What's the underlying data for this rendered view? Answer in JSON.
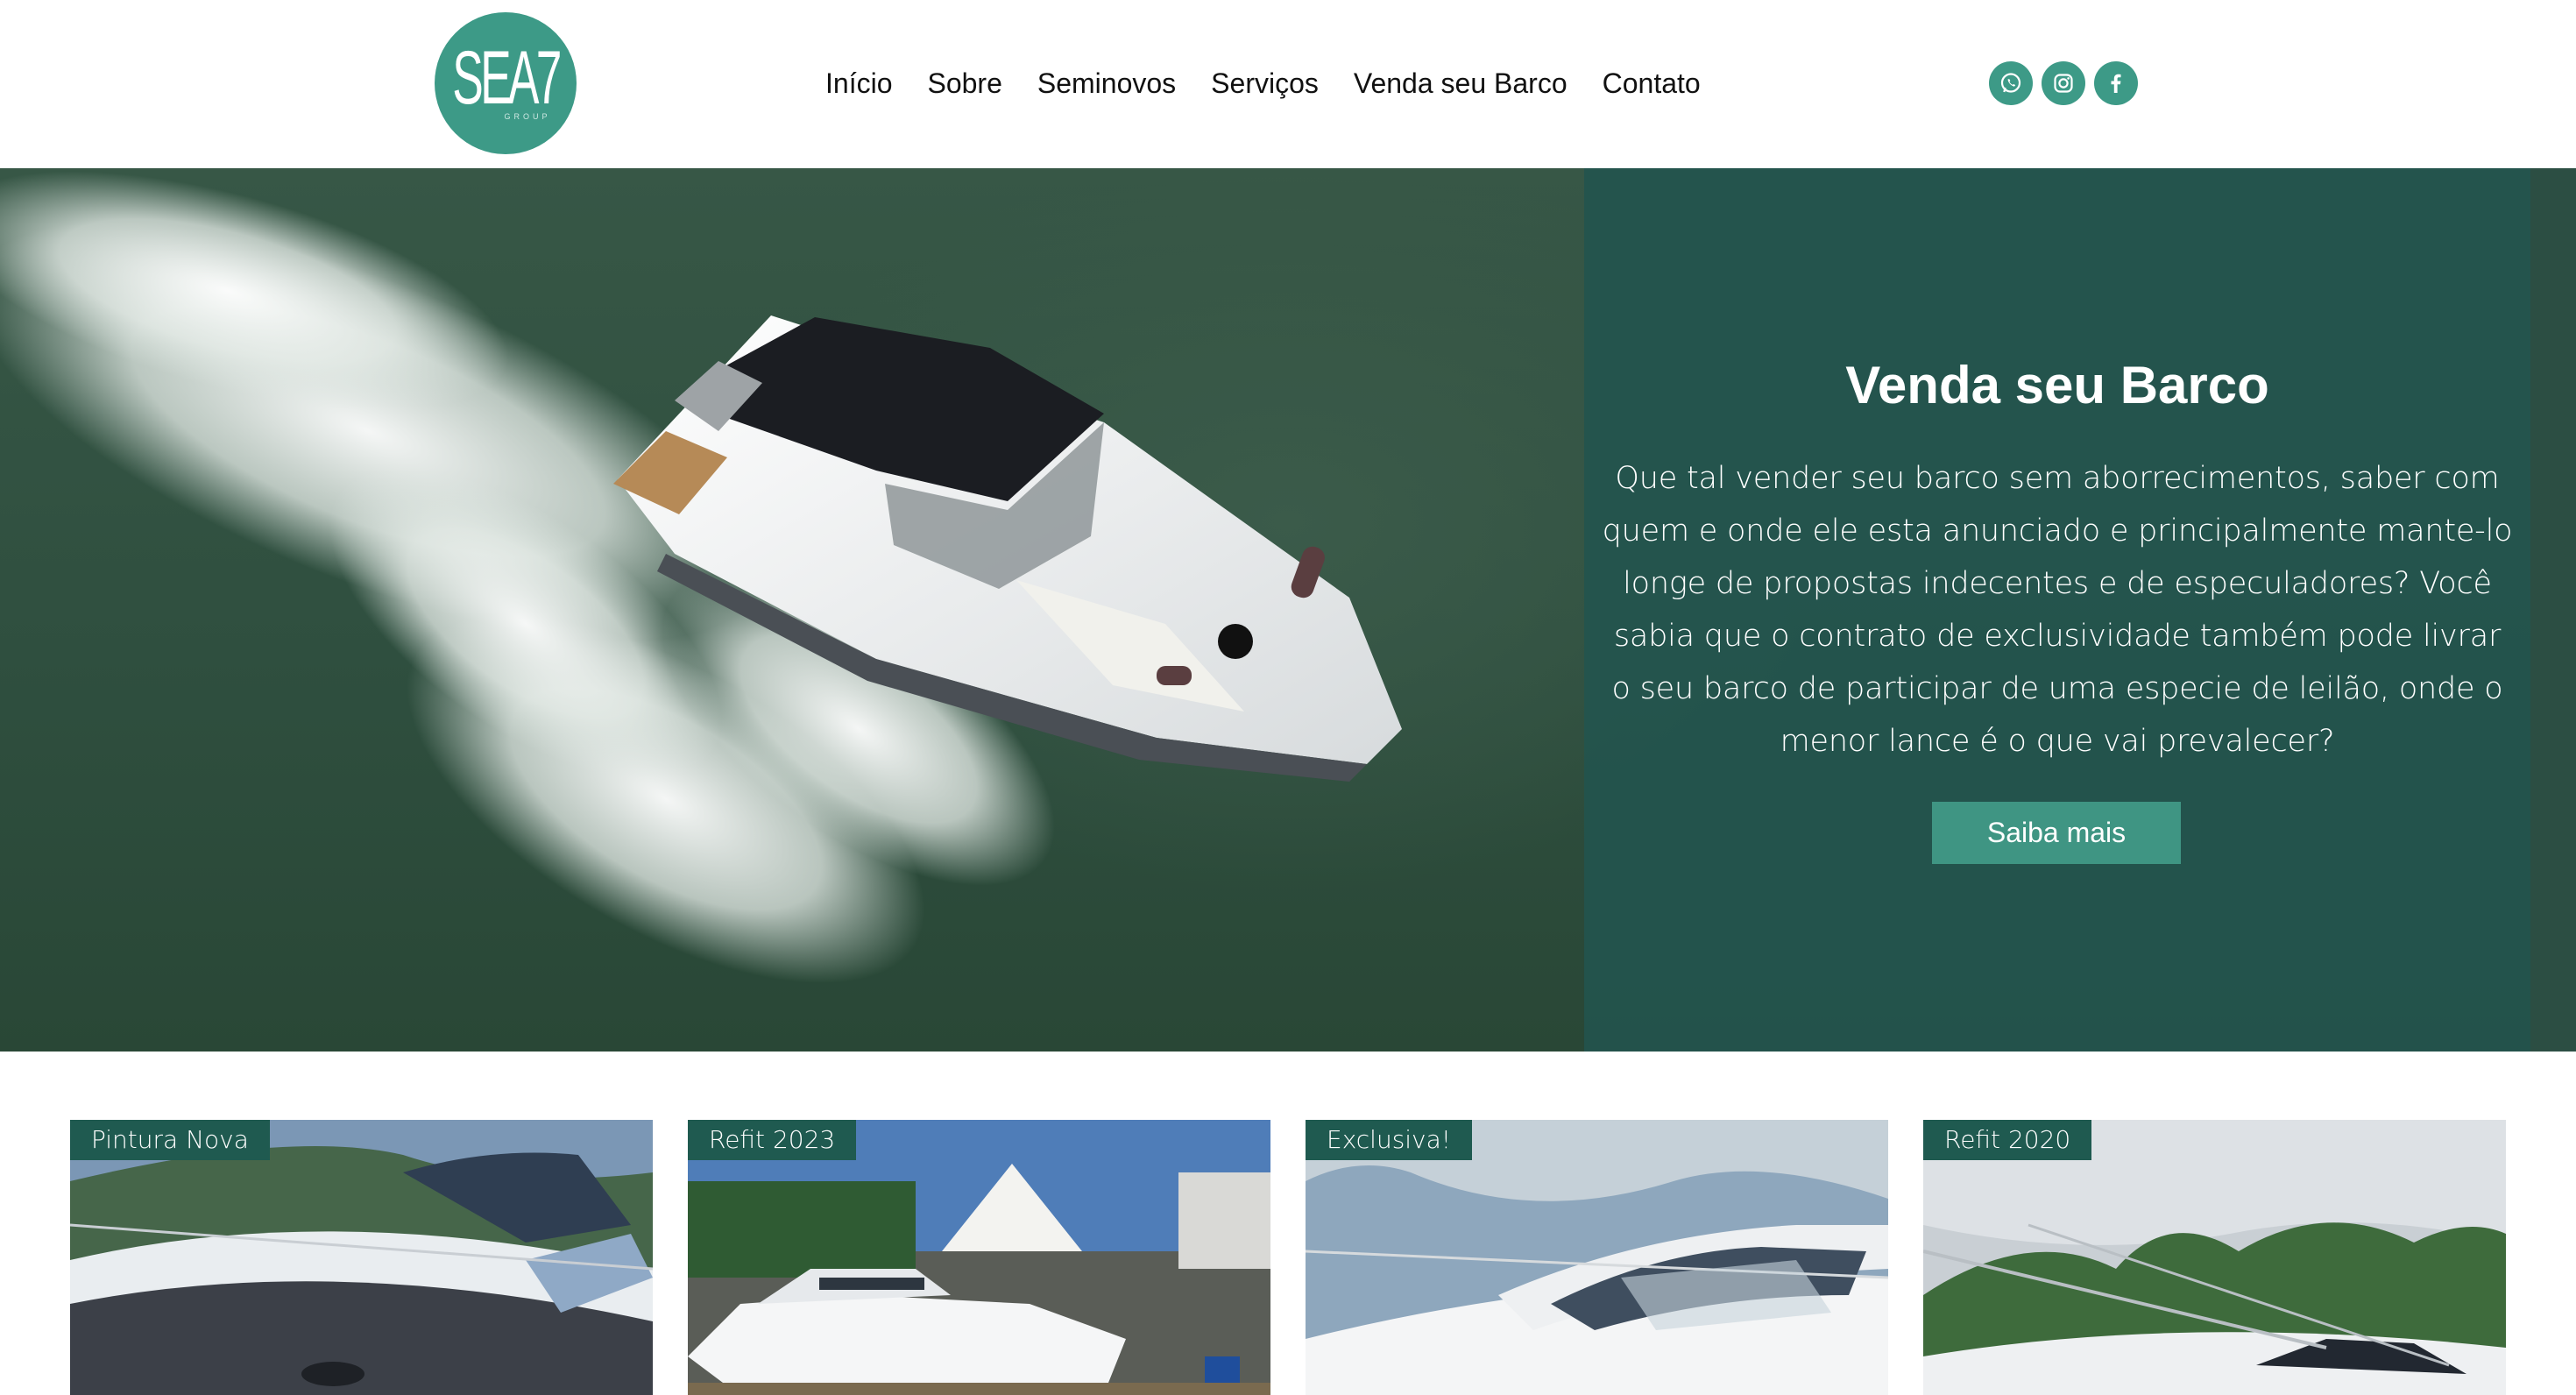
{
  "header": {
    "logo_text": "SEA7",
    "logo_subtext": "GROUP",
    "nav": [
      {
        "label": "Início"
      },
      {
        "label": "Sobre"
      },
      {
        "label": "Seminovos"
      },
      {
        "label": "Serviços"
      },
      {
        "label": "Venda seu Barco"
      },
      {
        "label": "Contato"
      }
    ],
    "social": [
      {
        "icon": "whatsapp-icon"
      },
      {
        "icon": "instagram-icon"
      },
      {
        "icon": "facebook-icon"
      }
    ]
  },
  "hero": {
    "title": "Venda seu Barco",
    "text": "Que tal vender seu barco sem aborrecimentos, saber com quem e onde ele esta anunciado e principalmente mante-lo longe de propostas indecentes e de especuladores? Você sabia que o contrato de exclusividade também pode livrar o seu barco de participar de uma especie de leilão, onde o menor lance é o que vai prevalecer?",
    "button_label": "Saiba mais"
  },
  "cards": [
    {
      "badge": "Pintura Nova"
    },
    {
      "badge": "Refit 2023"
    },
    {
      "badge": "Exclusiva!"
    },
    {
      "badge": "Refit 2020"
    }
  ],
  "colors": {
    "brand": "#3d9a87",
    "panel": "#22544e",
    "badge": "#1f5a50",
    "button": "#3f9583"
  }
}
